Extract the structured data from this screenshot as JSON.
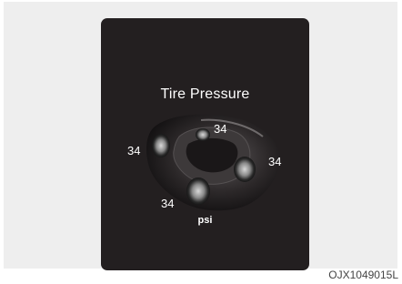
{
  "screen": {
    "title": "Tire Pressure",
    "unit": "psi",
    "pressures": {
      "front_left": "34",
      "front_right": "34",
      "rear_left": "34",
      "rear_right": "34"
    }
  },
  "caption": "OJX1049015L",
  "colors": {
    "background_panel": "#eeeeee",
    "screen": "#231f20",
    "text": "#ffffff"
  },
  "icons": {
    "car": "car-top-view-icon"
  }
}
